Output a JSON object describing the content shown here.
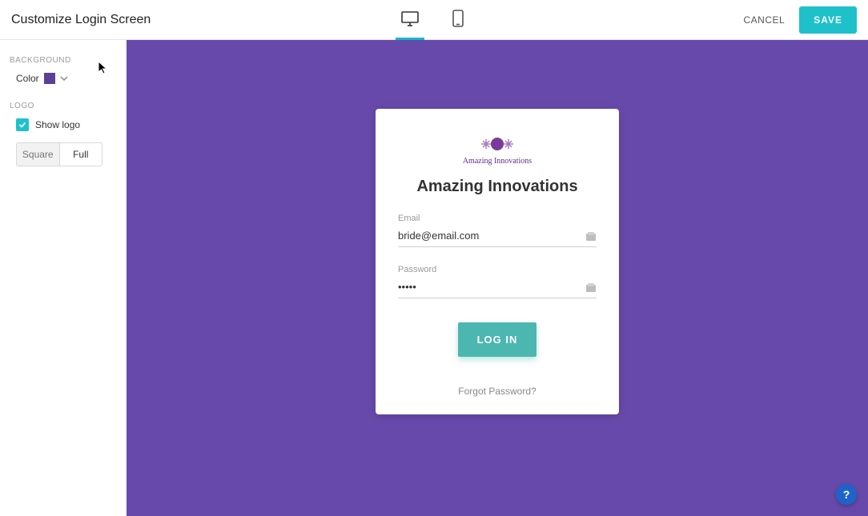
{
  "header": {
    "title": "Customize Login Screen",
    "cancel_label": "CANCEL",
    "save_label": "SAVE"
  },
  "sidebar": {
    "background": {
      "section_label": "BACKGROUND",
      "color_label": "Color",
      "color_value": "#5b4096"
    },
    "logo": {
      "section_label": "LOGO",
      "show_logo_label": "Show logo",
      "show_logo_checked": true,
      "segments": {
        "square": "Square",
        "full": "Full",
        "selected": "square"
      }
    }
  },
  "preview": {
    "background_color": "#6749ab",
    "brand_name": "Amazing Innovations",
    "logo_text": "Amazing Innovations",
    "fields": {
      "email": {
        "label": "Email",
        "value": "bride@email.com"
      },
      "password": {
        "label": "Password",
        "value": "•••••"
      }
    },
    "login_label": "LOG IN",
    "forgot_label": "Forgot Password?"
  },
  "help": {
    "glyph": "?"
  }
}
